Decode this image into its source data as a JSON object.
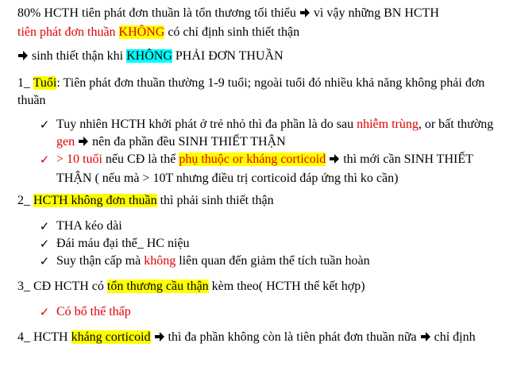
{
  "lines": {
    "l1a": "80% HCTH tiên phát đơn thuần là tổn thương tối thiểu",
    "l1b": "vì vậy những BN HCTH",
    "l2a": "tiên phát đơn thuần",
    "l2b": "KHÔNG",
    "l2c": "có chỉ định sinh thiết thận",
    "l3a": "sinh thiết thận khi",
    "l3b": "KHÔNG",
    "l3c": "PHẢI ĐƠN THUẦN",
    "s1a": "1_ ",
    "s1b": "Tuổi",
    "s1c": ": Tiên phát đơn thuần thường 1-9 tuổi; ngoài tuổi đó nhiều khả năng không phải đơn thuần",
    "b1a": "Tuy nhiên HCTH khởi phát ở trẻ nhỏ thì đa phần là do sau",
    "b1b": "nhiễm trùng",
    "b1c": ", or bất thường",
    "b1d": "gen",
    "b1e": "nên đa phần đều SINH THIẾT THẬN",
    "b2a": "> 10 tuổi",
    "b2b": "nếu  CĐ là thể",
    "b2c": "phụ thuộc or kháng corticoid",
    "b2d": "thì mới cần SINH THIẾT THẬN ( nếu mà > 10T nhưng điều trị corticoid đáp ứng thì ko cần)",
    "s2a": "2_ ",
    "s2b": "HCTH không đơn thuần",
    "s2c": "thì phải sinh thiết thận",
    "b3": "THA kéo dài",
    "b4": "Đái máu đại thể_ HC niệu",
    "b5a": "Suy thận cấp mà",
    "b5b": "không",
    "b5c": "liên quan đến giảm thể tích tuần hoàn",
    "s3a": "3_ CĐ HCTH có",
    "s3b": "tổn thương cầu thận",
    "s3c": "kèm theo( HCTH thể kết hợp)",
    "b6": "Có bổ thể thấp",
    "s4a": "4_ HCTH",
    "s4b": "kháng corticoid",
    "s4c": "thì đa phần không còn là tiên phát đơn thuần nữa",
    "s4d": "chỉ định"
  },
  "icons": {
    "arrow": "right-arrow-icon",
    "check": "check-mark-icon"
  },
  "colors": {
    "red": "#e00000",
    "yellow_highlight": "#ffff00",
    "cyan_highlight": "#00ffff"
  }
}
